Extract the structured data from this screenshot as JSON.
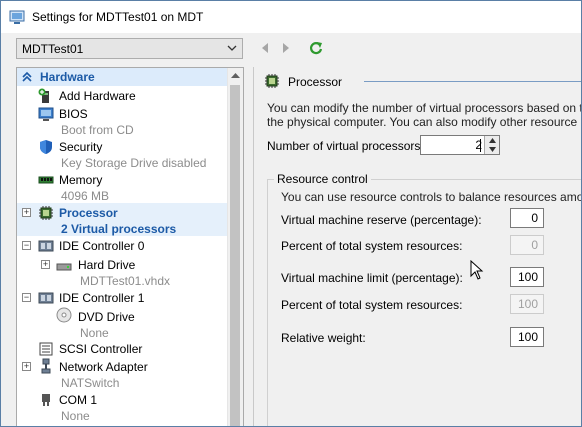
{
  "window": {
    "title": "Settings for MDTTest01 on MDT"
  },
  "toolbar": {
    "vm_selected": "MDTTest01"
  },
  "tree": {
    "section_label": "Hardware",
    "items": [
      {
        "label": "Add Hardware",
        "sub": "",
        "icon": "add-hardware-icon"
      },
      {
        "label": "BIOS",
        "sub": "Boot from CD",
        "icon": "bios-icon"
      },
      {
        "label": "Security",
        "sub": "Key Storage Drive disabled",
        "icon": "security-shield-icon"
      },
      {
        "label": "Memory",
        "sub": "4096 MB",
        "icon": "memory-icon"
      },
      {
        "label": "Processor",
        "sub": "2 Virtual processors",
        "icon": "processor-icon"
      },
      {
        "label": "IDE Controller 0",
        "sub": "",
        "icon": "ide-controller-icon"
      },
      {
        "label": "Hard Drive",
        "sub": "MDTTest01.vhdx",
        "icon": "hard-drive-icon"
      },
      {
        "label": "IDE Controller 1",
        "sub": "",
        "icon": "ide-controller-icon"
      },
      {
        "label": "DVD Drive",
        "sub": "None",
        "icon": "dvd-drive-icon"
      },
      {
        "label": "SCSI Controller",
        "sub": "",
        "icon": "scsi-controller-icon"
      },
      {
        "label": "Network Adapter",
        "sub": "NATSwitch",
        "icon": "network-adapter-icon"
      },
      {
        "label": "COM 1",
        "sub": "None",
        "icon": "com-port-icon"
      }
    ]
  },
  "panel": {
    "title": "Processor",
    "desc_line1": "You can modify the number of virtual processors based on the nu",
    "desc_line2": "the physical computer. You can also modify other resource contro",
    "vp_label": "Number of virtual processors:",
    "vp_value": "2",
    "resource_control": {
      "title": "Resource control",
      "desc": "You can use resource controls to balance resources among virtu",
      "reserve_label": "Virtual machine reserve (percentage):",
      "reserve_value": "0",
      "reserve_pct_label": "Percent of total system resources:",
      "reserve_pct_value": "0",
      "limit_label": "Virtual machine limit (percentage):",
      "limit_value": "100",
      "limit_pct_label": "Percent of total system resources:",
      "limit_pct_value": "100",
      "weight_label": "Relative weight:",
      "weight_value": "100"
    }
  },
  "colors": {
    "accent": "#1c5aa6",
    "selection": "#e5f0fb",
    "header_bg": "#dcebfb",
    "refresh_green": "#2f9a2f"
  }
}
